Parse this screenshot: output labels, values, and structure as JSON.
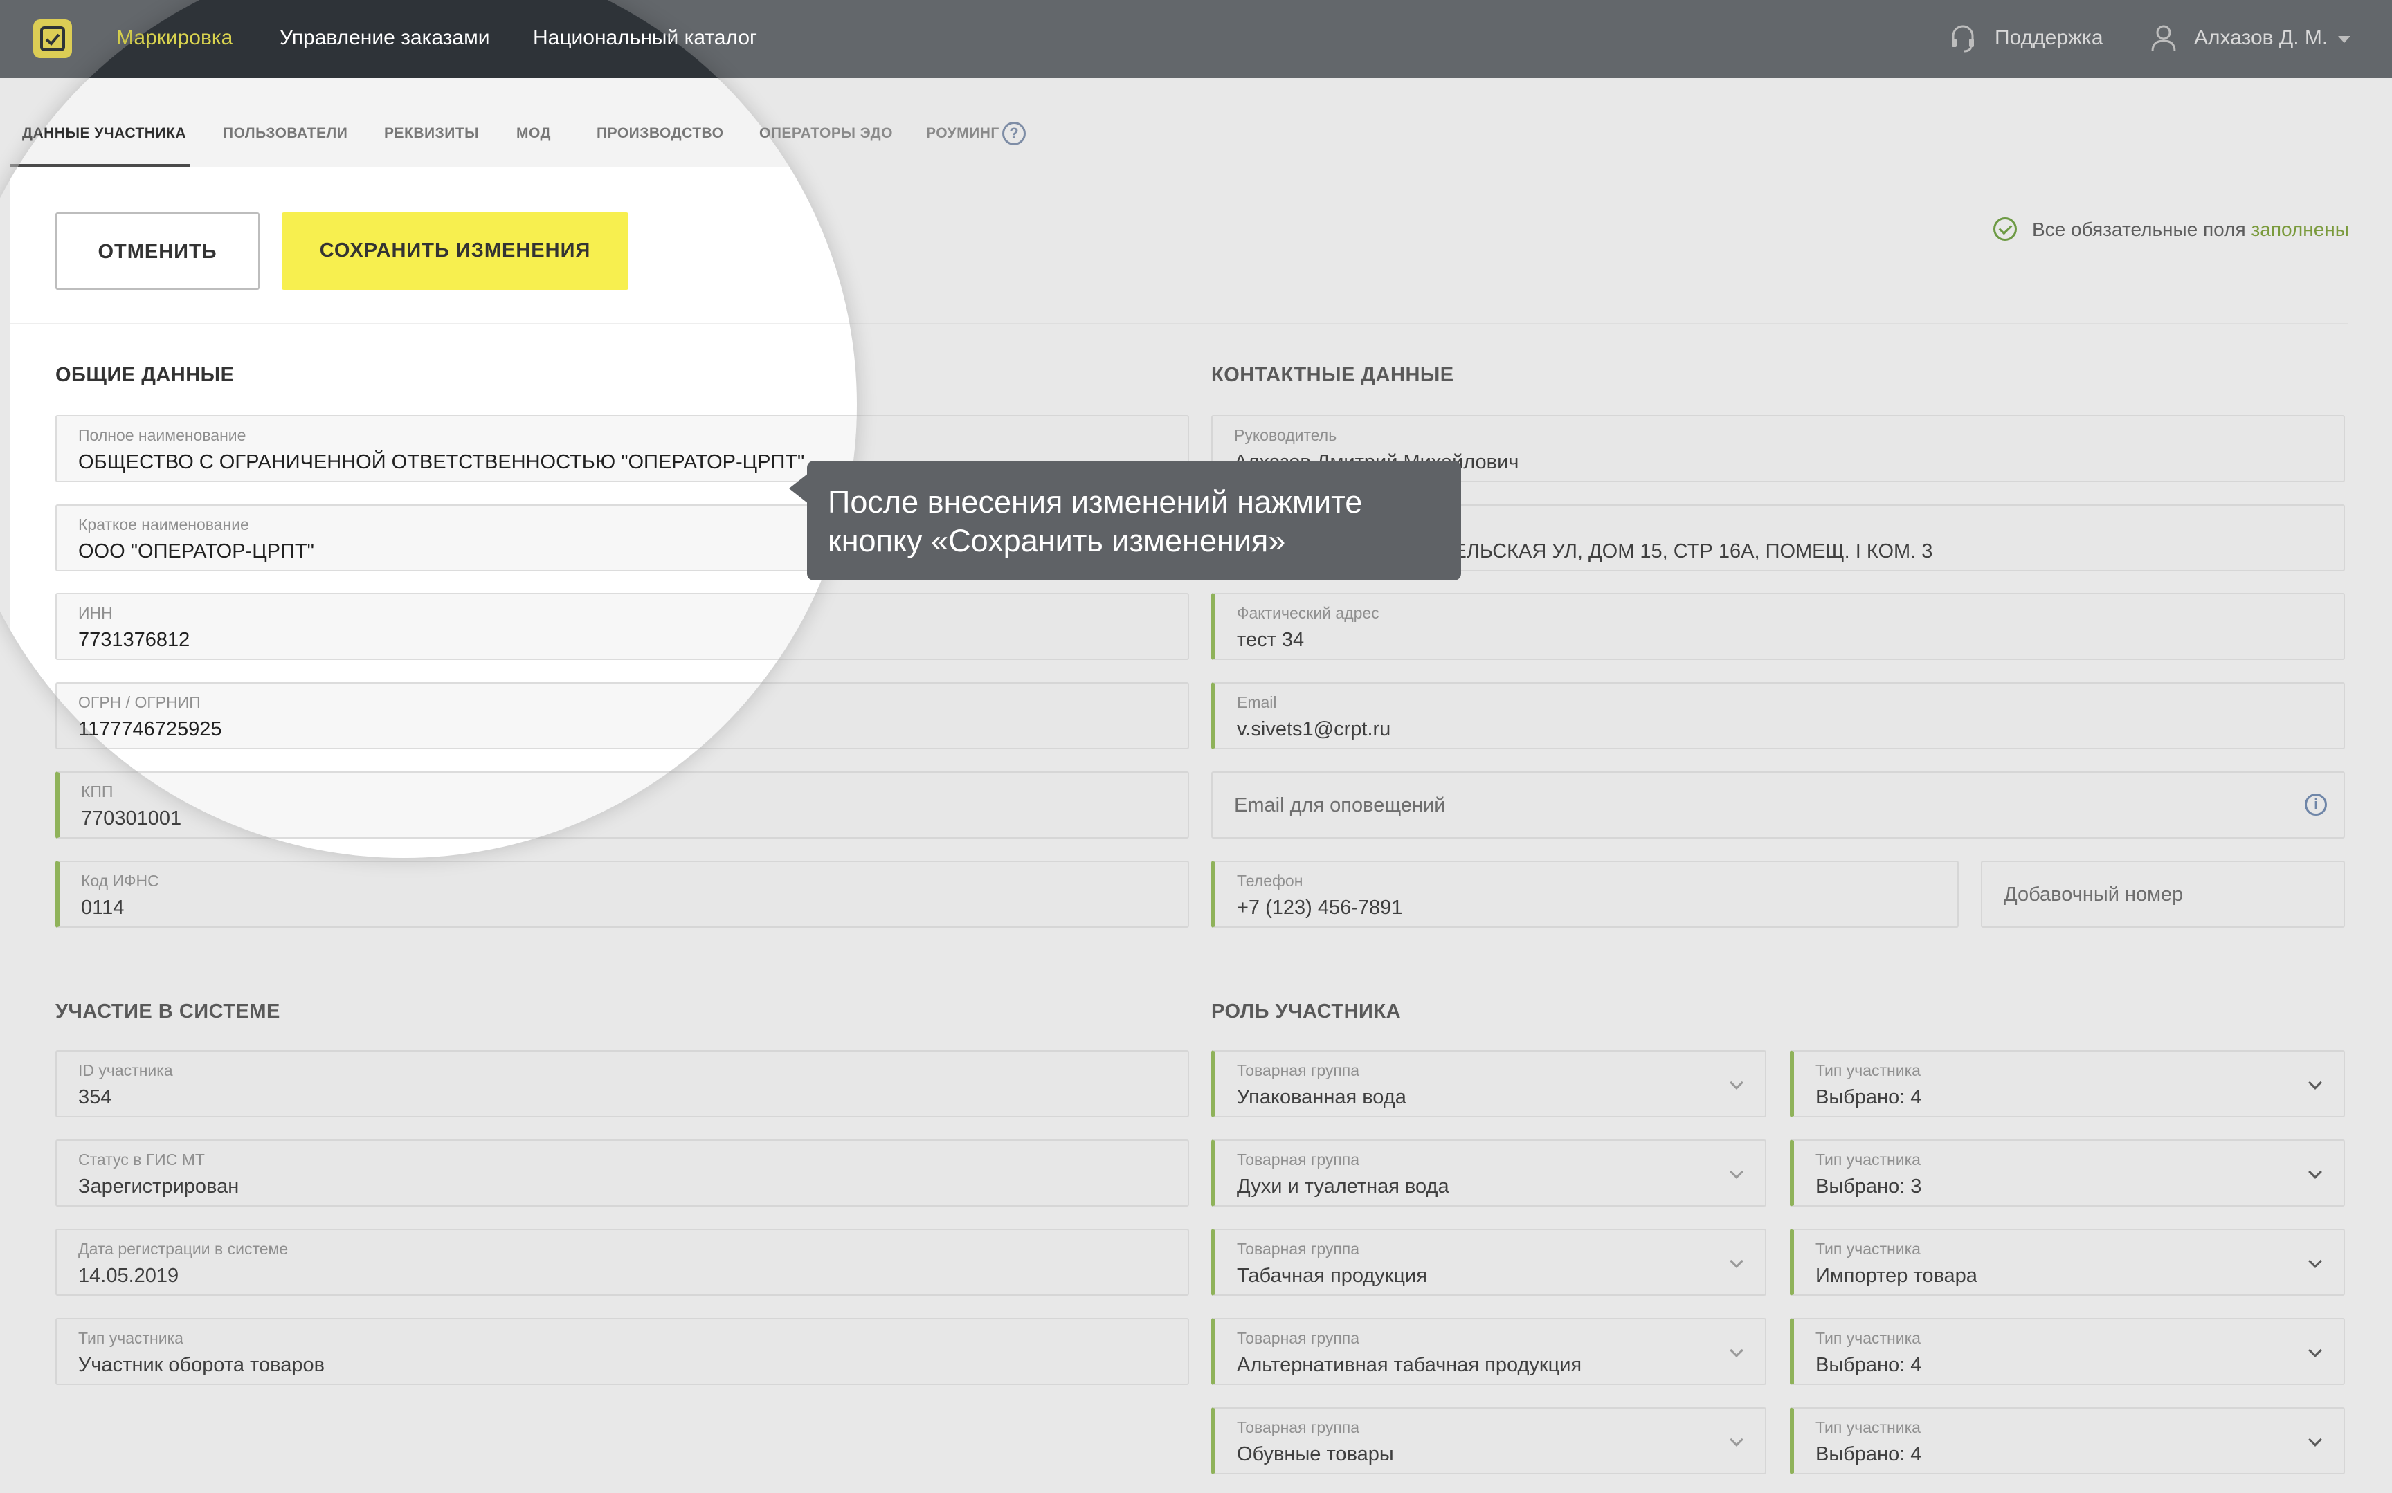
{
  "nav": {
    "items": [
      "Маркировка",
      "Управление заказами",
      "Национальный каталог"
    ],
    "support": "Поддержка",
    "user": "Алхазов Д. М."
  },
  "tabs": [
    "ДАННЫЕ УЧАСТНИКА",
    "ПОЛЬЗОВАТЕЛИ",
    "РЕКВИЗИТЫ",
    "МОД",
    "ПРОИЗВОДСТВО",
    "ОПЕРАТОРЫ ЭДО",
    "РОУМИНГ"
  ],
  "actions": {
    "cancel": "ОТМЕНИТЬ",
    "save": "СОХРАНИТЬ ИЗМЕНЕНИЯ",
    "status_prefix": "Все обязательные поля ",
    "status_ok": "заполнены"
  },
  "general": {
    "title": "ОБЩИЕ ДАННЫЕ",
    "fields": [
      {
        "label": "Полное наименование",
        "value": "ОБЩЕСТВО С ОГРАНИЧЕННОЙ ОТВЕТСТВЕННОСТЬЮ \"ОПЕРАТОР-ЦРПТ\""
      },
      {
        "label": "Краткое наименование",
        "value": "ООО \"ОПЕРАТОР-ЦРПТ\""
      },
      {
        "label": "ИНН",
        "value": "7731376812"
      },
      {
        "label": "ОГРН / ОГРНИП",
        "value": "1177746725925"
      },
      {
        "label": "КПП",
        "value": "770301001"
      },
      {
        "label": "Код ИФНС",
        "value": "0114"
      }
    ]
  },
  "contacts": {
    "title": "КОНТАКТНЫЕ ДАННЫЕ",
    "head_label": "Руководитель",
    "head_value": "Алхазов Дмитрий Михайлович",
    "legal_address_value": "ЦЕЛЬСКАЯ УЛ, ДОМ 15, СТР 16А, ПОМЕЩ. I КОМ. 3",
    "actual_address_label": "Фактический адрес",
    "actual_address_value": "тест 34",
    "email_label": "Email",
    "email_value": "v.sivets1@crpt.ru",
    "notify_email_placeholder": "Email для оповещений",
    "phone_label": "Телефон",
    "phone_value": "+7 (123) 456-7891",
    "ext_placeholder": "Добавочный номер"
  },
  "system": {
    "title": "УЧАСТИЕ В СИСТЕМЕ",
    "fields": [
      {
        "label": "ID участника",
        "value": "354"
      },
      {
        "label": "Статус в ГИС МТ",
        "value": "Зарегистрирован"
      },
      {
        "label": "Дата регистрации в системе",
        "value": "14.05.2019"
      },
      {
        "label": "Тип участника",
        "value": "Участник оборота товаров"
      }
    ]
  },
  "roles": {
    "title": "РОЛЬ УЧАСТНИКА",
    "group_label": "Товарная группа",
    "type_label": "Тип участника",
    "rows": [
      {
        "group": "Упакованная вода",
        "type": "Выбрано: 4"
      },
      {
        "group": "Духи и туалетная вода",
        "type": "Выбрано: 3"
      },
      {
        "group": "Табачная продукция",
        "type": "Импортер товара"
      },
      {
        "group": "Альтернативная табачная продукция",
        "type": "Выбрано: 4"
      },
      {
        "group": "Обувные товары",
        "type": "Выбрано: 4"
      }
    ]
  },
  "tooltip": {
    "text": "После внесения изменений нажмите кнопку «Сохранить изменения»"
  }
}
